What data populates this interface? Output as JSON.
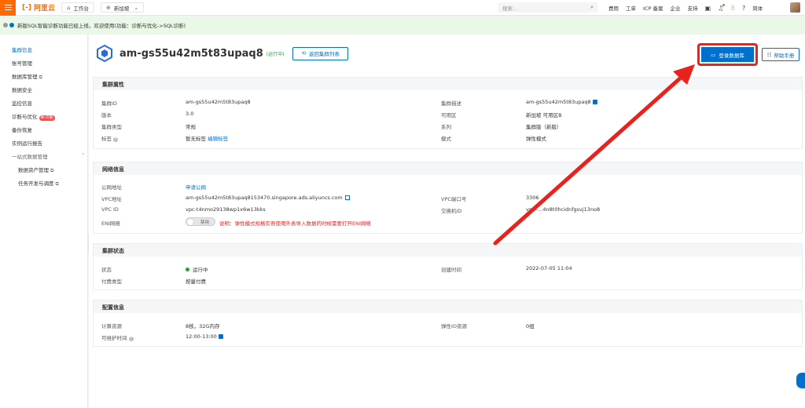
{
  "topbar": {
    "logo_text": "阿里云",
    "logo_mark": "[-]",
    "workbench_label": "工作台",
    "region_label": "新加坡",
    "search_placeholder": "搜索...",
    "links": [
      "费用",
      "工单",
      "ICP 备案",
      "企业",
      "支持"
    ],
    "language_label": "简体",
    "icons": [
      "menu-icon",
      "home-icon",
      "globe-icon",
      "search-icon",
      "terminal-icon",
      "bell-icon",
      "lightbulb-icon",
      "help-icon",
      "avatar"
    ]
  },
  "notice": {
    "text": "新版SQL智能诊断功能已经上线，欢迎使用(功能：诊断与优化->SQL诊断)"
  },
  "sidebar": {
    "items": [
      {
        "label": "集群信息",
        "active": true
      },
      {
        "label": "账号管理"
      },
      {
        "label": "数据库管理",
        "external": true
      },
      {
        "label": "数据安全"
      },
      {
        "label": "监控信息"
      },
      {
        "label": "诊断与优化",
        "badge": "新功能"
      },
      {
        "label": "备份恢复"
      },
      {
        "label": "实例运行报告"
      },
      {
        "label": "一站式数据管理",
        "group": true
      },
      {
        "label": "数据资产管理",
        "external": true,
        "sub": true
      },
      {
        "label": "任务开发与调度",
        "external": true,
        "sub": true
      }
    ]
  },
  "header": {
    "cluster_name": "am-gs55u42m5t83upaq8",
    "status": "(运行中)",
    "back_button": "返回集群列表",
    "login_button": "登录数据库",
    "help_button": "帮助手册"
  },
  "attributes": {
    "title": "集群属性",
    "left": [
      {
        "label": "集群ID",
        "value": "am-gs55u42m5t83upaq8"
      },
      {
        "label": "版本",
        "value": "3.0"
      },
      {
        "label": "集群类型",
        "value": "常规"
      },
      {
        "label": "标签",
        "value": "暂无标签",
        "link": "编辑标签"
      }
    ],
    "right": [
      {
        "label": "集群描述",
        "value": "am-gs55u42m5t83upaq8"
      },
      {
        "label": "可用区",
        "value": "新加坡 可用区B"
      },
      {
        "label": "系列",
        "value": "集群版（新版）"
      },
      {
        "label": "模式",
        "value": "弹性模式"
      }
    ]
  },
  "network": {
    "title": "网络信息",
    "left": [
      {
        "label": "公网地址",
        "value": "申请公网"
      },
      {
        "label": "VPC地址",
        "value": "am-gs55u42m5t83upaq8153470.singapore.ads.aliyuncs.com"
      },
      {
        "label": "VPC ID",
        "value": "vpc-t4nmo29138wp1x6w13kks"
      },
      {
        "label": "ENI网络",
        "toggle": "禁用",
        "note": "说明：弹性模式规格实例使用外表导入数据的时候需要打开ENI网络"
      }
    ],
    "right": [
      {
        "label": "VPC端口号",
        "value": "3306"
      },
      {
        "label": "交换机ID",
        "value": "vsw-…4n8t0hcidnfgsvj13no8"
      }
    ]
  },
  "status": {
    "title": "集群状态",
    "left": [
      {
        "label": "状态",
        "value": "运行中"
      },
      {
        "label": "付费类型",
        "value": "按量付费"
      }
    ],
    "right": [
      {
        "label": "创建时间",
        "value": "2022-07-05 11:04"
      }
    ]
  },
  "config": {
    "title": "配置信息",
    "left": [
      {
        "label": "计算资源",
        "value": "8核，32G内存"
      },
      {
        "label": "可维护时间",
        "value": "12:00-13:00"
      }
    ],
    "right": [
      {
        "label": "弹性IO资源",
        "value": "0组"
      }
    ]
  },
  "colors": {
    "brand": "#ff6a00",
    "primary": "#0070cc",
    "highlight": "#e8231e",
    "running": "#2a9d3c"
  }
}
